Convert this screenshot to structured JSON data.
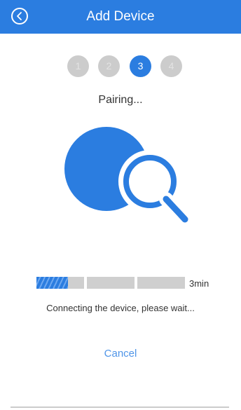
{
  "header": {
    "title": "Add Device",
    "back_icon": "chevron-left-circle-icon",
    "background": "#2b7de0"
  },
  "steps": {
    "items": [
      "1",
      "2",
      "3",
      "4"
    ],
    "current": "3"
  },
  "status": {
    "text": "Pairing..."
  },
  "illustration": {
    "icon": "search-magnifier-icon",
    "color": "#2b7de0"
  },
  "progress": {
    "fraction": 0.12,
    "time_label": "3min",
    "fill_color": "#2b7de0"
  },
  "hint": {
    "text": "Connecting the device, please wait..."
  },
  "actions": {
    "cancel_label": "Cancel",
    "link_color": "#4f95e8"
  }
}
